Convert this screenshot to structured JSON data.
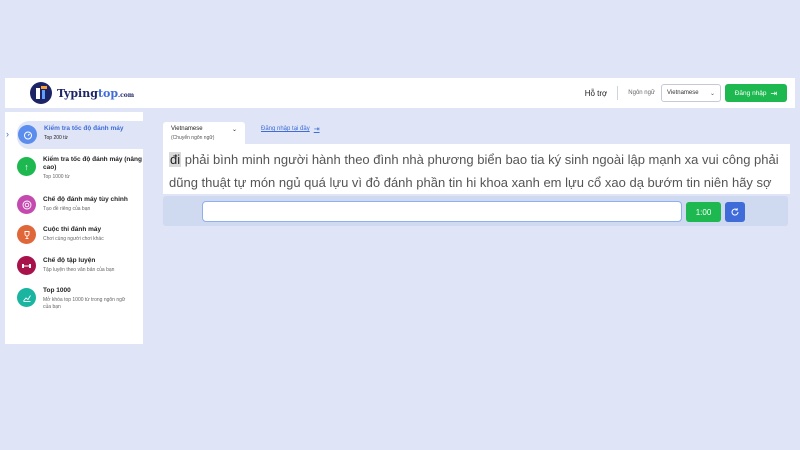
{
  "header": {
    "logo_brand": "Typing",
    "logo_accent": "top",
    "logo_suffix": ".com",
    "help_label": "Hỗ trợ",
    "language_label": "Ngôn ngữ",
    "language_selected": "Vietnamese",
    "login_label": "Đăng nhập"
  },
  "sidebar": {
    "items": [
      {
        "title": "Kiểm tra tốc độ đánh máy",
        "subtitle": "Top 200 từ",
        "icon": "stopwatch-icon",
        "color": "#5b8dee"
      },
      {
        "title": "Kiểm tra tốc độ đánh máy (nâng cao)",
        "subtitle": "Top 1000 từ",
        "icon": "arrow-up-icon",
        "color": "#1db84f"
      },
      {
        "title": "Chế độ đánh máy tùy chỉnh",
        "subtitle": "Tạo đề riêng của bạn",
        "icon": "target-icon",
        "color": "#c44ab0"
      },
      {
        "title": "Cuộc thi đánh máy",
        "subtitle": "Chơi cùng người chơi khác",
        "icon": "trophy-icon",
        "color": "#e0673a"
      },
      {
        "title": "Chế độ tập luyện",
        "subtitle": "Tập luyện theo văn bản của bạn",
        "icon": "dumbbell-icon",
        "color": "#a8124a"
      },
      {
        "title": "Top 1000",
        "subtitle": "Mở khóa top 1000 từ trong ngôn ngữ của bạn",
        "icon": "chart-icon",
        "color": "#1ab5a0"
      }
    ]
  },
  "main": {
    "tab_language": "Vietnamese",
    "tab_change": "(Chuyển ngôn ngữ)",
    "login_here": "Đăng nhập tại đây",
    "current_word": "đi",
    "words": "phải bình minh người hành theo đình nhà phương biển bao tia ký sinh ngoài lập mạnh xa vui công phải dũng thuật tự món ngủ quá lựu vì đỏ đánh phần tin hi khoa xanh em lựu cổ xao dạ bướm tin niên hãy sợ",
    "input_value": "",
    "timer": "1:00"
  },
  "colors": {
    "background": "#dfe5f6",
    "accent_green": "#1db84f",
    "accent_blue": "#3f6cd8"
  }
}
